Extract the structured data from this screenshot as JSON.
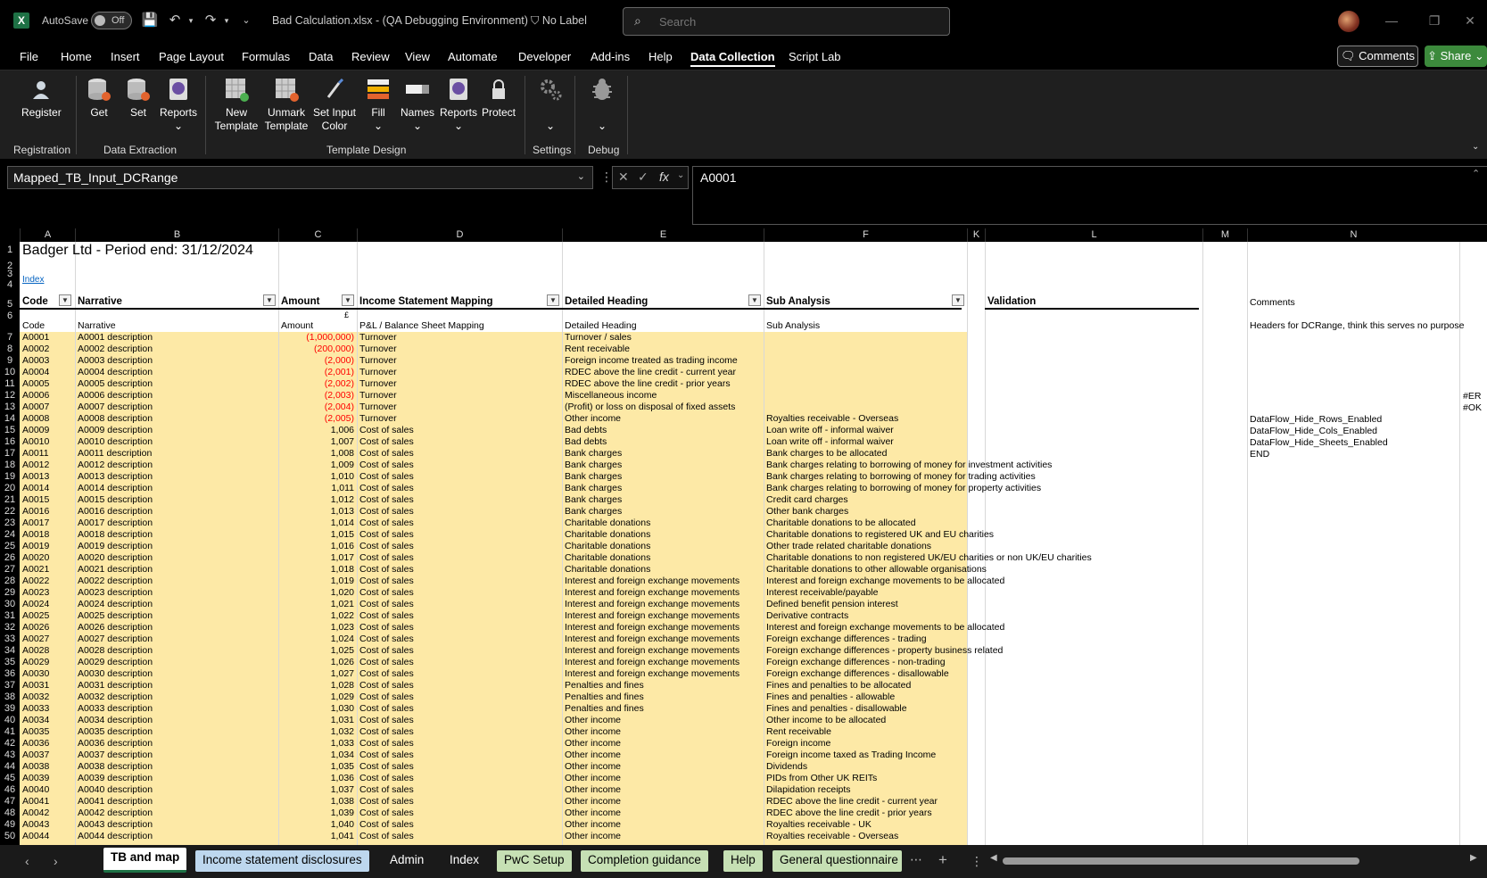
{
  "titlebar": {
    "app_icon": "excel-logo",
    "autosave_label": "AutoSave",
    "autosave_state": "Off",
    "doc_title": "Bad Calculation.xlsx  -  (QA Debugging Environment)",
    "label": "No Label",
    "search_placeholder": "Search"
  },
  "menu": {
    "items": [
      "File",
      "Home",
      "Insert",
      "Page Layout",
      "Formulas",
      "Data",
      "Review",
      "View",
      "Automate",
      "Developer",
      "Add-ins",
      "Help",
      "Data Collection",
      "Script Lab"
    ],
    "active": "Data Collection",
    "comments_label": "Comments",
    "share_label": "Share"
  },
  "ribbon": {
    "buttons": {
      "register": "Register",
      "get": "Get",
      "set": "Set",
      "reports": "Reports",
      "new_template_1": "New",
      "new_template_2": "Template",
      "unmark_template_1": "Unmark",
      "unmark_template_2": "Template",
      "set_input_color_1": "Set Input",
      "set_input_color_2": "Color",
      "fill": "Fill",
      "names": "Names",
      "reports2": "Reports",
      "protect": "Protect"
    },
    "groups": {
      "registration": "Registration",
      "data_extraction": "Data Extraction",
      "template_design": "Template Design",
      "settings": "Settings",
      "debug": "Debug"
    }
  },
  "formula_bar": {
    "name_box": "Mapped_TB_Input_DCRange",
    "formula": "A0001"
  },
  "columns": [
    "A",
    "B",
    "C",
    "D",
    "E",
    "F",
    "K",
    "L",
    "M",
    "N"
  ],
  "sheet": {
    "title": "Badger Ltd - Period end: 31/12/2024",
    "index_link": "Index",
    "headers": {
      "code": "Code",
      "narrative": "Narrative",
      "amount": "Amount",
      "is_mapping": "Income Statement Mapping",
      "detailed_heading": "Detailed Heading",
      "sub_analysis": "Sub Analysis",
      "validation": "Validation",
      "comments": "Comments"
    },
    "currency": "£",
    "row6": {
      "code": "Code",
      "narrative": "Narrative",
      "amount": "Amount",
      "mapping": "P&L / Balance Sheet Mapping",
      "detailed": "Detailed Heading",
      "sub": "Sub Analysis",
      "comments": "Headers for DCRange, think this serves no purpose"
    },
    "comment_rows": [
      "DataFlow_Hide_Rows_Enabled",
      "DataFlow_Hide_Cols_Enabled",
      "DataFlow_Hide_Sheets_Enabled",
      "END"
    ],
    "edge_values": [
      "#ER",
      "#OK"
    ],
    "rows": [
      [
        "A0001",
        "A0001 description",
        "(1,000,000)",
        "Turnover",
        "Turnover / sales",
        ""
      ],
      [
        "A0002",
        "A0002 description",
        "(200,000)",
        "Turnover",
        "Rent receivable",
        ""
      ],
      [
        "A0003",
        "A0003 description",
        "(2,000)",
        "Turnover",
        "Foreign income treated as trading income",
        ""
      ],
      [
        "A0004",
        "A0004 description",
        "(2,001)",
        "Turnover",
        "RDEC above the line credit - current year",
        ""
      ],
      [
        "A0005",
        "A0005 description",
        "(2,002)",
        "Turnover",
        "RDEC above the line credit - prior years",
        ""
      ],
      [
        "A0006",
        "A0006 description",
        "(2,003)",
        "Turnover",
        "Miscellaneous income",
        ""
      ],
      [
        "A0007",
        "A0007 description",
        "(2,004)",
        "Turnover",
        "(Profit) or loss on disposal of fixed assets",
        ""
      ],
      [
        "A0008",
        "A0008 description",
        "(2,005)",
        "Turnover",
        "Other income",
        "Royalties receivable - Overseas"
      ],
      [
        "A0009",
        "A0009 description",
        "1,006",
        "Cost of sales",
        "Bad debts",
        "Loan write off - informal waiver"
      ],
      [
        "A0010",
        "A0010 description",
        "1,007",
        "Cost of sales",
        "Bad debts",
        "Loan write off - informal waiver"
      ],
      [
        "A0011",
        "A0011 description",
        "1,008",
        "Cost of sales",
        "Bank charges",
        "Bank charges to be allocated"
      ],
      [
        "A0012",
        "A0012 description",
        "1,009",
        "Cost of sales",
        "Bank charges",
        "Bank charges relating to borrowing of money for investment activities"
      ],
      [
        "A0013",
        "A0013 description",
        "1,010",
        "Cost of sales",
        "Bank charges",
        "Bank charges relating to borrowing of money for trading activities"
      ],
      [
        "A0014",
        "A0014 description",
        "1,011",
        "Cost of sales",
        "Bank charges",
        "Bank charges relating to borrowing of money for property activities"
      ],
      [
        "A0015",
        "A0015 description",
        "1,012",
        "Cost of sales",
        "Bank charges",
        "Credit card charges"
      ],
      [
        "A0016",
        "A0016 description",
        "1,013",
        "Cost of sales",
        "Bank charges",
        "Other bank charges"
      ],
      [
        "A0017",
        "A0017 description",
        "1,014",
        "Cost of sales",
        "Charitable donations",
        "Charitable donations to be allocated"
      ],
      [
        "A0018",
        "A0018 description",
        "1,015",
        "Cost of sales",
        "Charitable donations",
        "Charitable donations to registered UK and EU charities"
      ],
      [
        "A0019",
        "A0019 description",
        "1,016",
        "Cost of sales",
        "Charitable donations",
        "Other trade related charitable donations"
      ],
      [
        "A0020",
        "A0020 description",
        "1,017",
        "Cost of sales",
        "Charitable donations",
        "Charitable donations to non registered UK/EU charities or non UK/EU charities"
      ],
      [
        "A0021",
        "A0021 description",
        "1,018",
        "Cost of sales",
        "Charitable donations",
        "Charitable donations to other allowable organisations"
      ],
      [
        "A0022",
        "A0022 description",
        "1,019",
        "Cost of sales",
        "Interest and foreign exchange movements",
        "Interest and foreign exchange movements to be allocated"
      ],
      [
        "A0023",
        "A0023 description",
        "1,020",
        "Cost of sales",
        "Interest and foreign exchange movements",
        "Interest receivable/payable"
      ],
      [
        "A0024",
        "A0024 description",
        "1,021",
        "Cost of sales",
        "Interest and foreign exchange movements",
        "Defined benefit pension interest"
      ],
      [
        "A0025",
        "A0025 description",
        "1,022",
        "Cost of sales",
        "Interest and foreign exchange movements",
        "Derivative contracts"
      ],
      [
        "A0026",
        "A0026 description",
        "1,023",
        "Cost of sales",
        "Interest and foreign exchange movements",
        "Interest and foreign exchange movements to be allocated"
      ],
      [
        "A0027",
        "A0027 description",
        "1,024",
        "Cost of sales",
        "Interest and foreign exchange movements",
        "Foreign exchange differences - trading"
      ],
      [
        "A0028",
        "A0028 description",
        "1,025",
        "Cost of sales",
        "Interest and foreign exchange movements",
        "Foreign exchange differences - property business related"
      ],
      [
        "A0029",
        "A0029 description",
        "1,026",
        "Cost of sales",
        "Interest and foreign exchange movements",
        "Foreign exchange differences - non-trading"
      ],
      [
        "A0030",
        "A0030 description",
        "1,027",
        "Cost of sales",
        "Interest and foreign exchange movements",
        "Foreign exchange differences - disallowable"
      ],
      [
        "A0031",
        "A0031 description",
        "1,028",
        "Cost of sales",
        "Penalties and fines",
        "Fines and penalties to be allocated"
      ],
      [
        "A0032",
        "A0032 description",
        "1,029",
        "Cost of sales",
        "Penalties and fines",
        "Fines and penalties - allowable"
      ],
      [
        "A0033",
        "A0033 description",
        "1,030",
        "Cost of sales",
        "Penalties and fines",
        "Fines and penalties - disallowable"
      ],
      [
        "A0034",
        "A0034 description",
        "1,031",
        "Cost of sales",
        "Other income",
        "Other income to be allocated"
      ],
      [
        "A0035",
        "A0035 description",
        "1,032",
        "Cost of sales",
        "Other income",
        "Rent receivable"
      ],
      [
        "A0036",
        "A0036 description",
        "1,033",
        "Cost of sales",
        "Other income",
        "Foreign income"
      ],
      [
        "A0037",
        "A0037 description",
        "1,034",
        "Cost of sales",
        "Other income",
        "Foreign income taxed as Trading Income"
      ],
      [
        "A0038",
        "A0038 description",
        "1,035",
        "Cost of sales",
        "Other income",
        "Dividends"
      ],
      [
        "A0039",
        "A0039 description",
        "1,036",
        "Cost of sales",
        "Other income",
        "PIDs from Other UK REITs"
      ],
      [
        "A0040",
        "A0040 description",
        "1,037",
        "Cost of sales",
        "Other income",
        "Dilapidation receipts"
      ],
      [
        "A0041",
        "A0041 description",
        "1,038",
        "Cost of sales",
        "Other income",
        "RDEC above the line credit - current year"
      ],
      [
        "A0042",
        "A0042 description",
        "1,039",
        "Cost of sales",
        "Other income",
        "RDEC above the line credit - prior years"
      ],
      [
        "A0043",
        "A0043 description",
        "1,040",
        "Cost of sales",
        "Other income",
        "Royalties receivable - UK"
      ],
      [
        "A0044",
        "A0044 description",
        "1,041",
        "Cost of sales",
        "Other income",
        "Royalties receivable - Overseas"
      ]
    ]
  },
  "tabs": [
    {
      "label": "TB and map",
      "style": "active"
    },
    {
      "label": "Income statement disclosures",
      "style": "blue"
    },
    {
      "label": "Admin",
      "style": "plain"
    },
    {
      "label": "Index",
      "style": "plain"
    },
    {
      "label": "PwC Setup",
      "style": "green"
    },
    {
      "label": "Completion guidance",
      "style": "green"
    },
    {
      "label": "Help",
      "style": "green"
    },
    {
      "label": "General questionnaire",
      "style": "green"
    }
  ]
}
